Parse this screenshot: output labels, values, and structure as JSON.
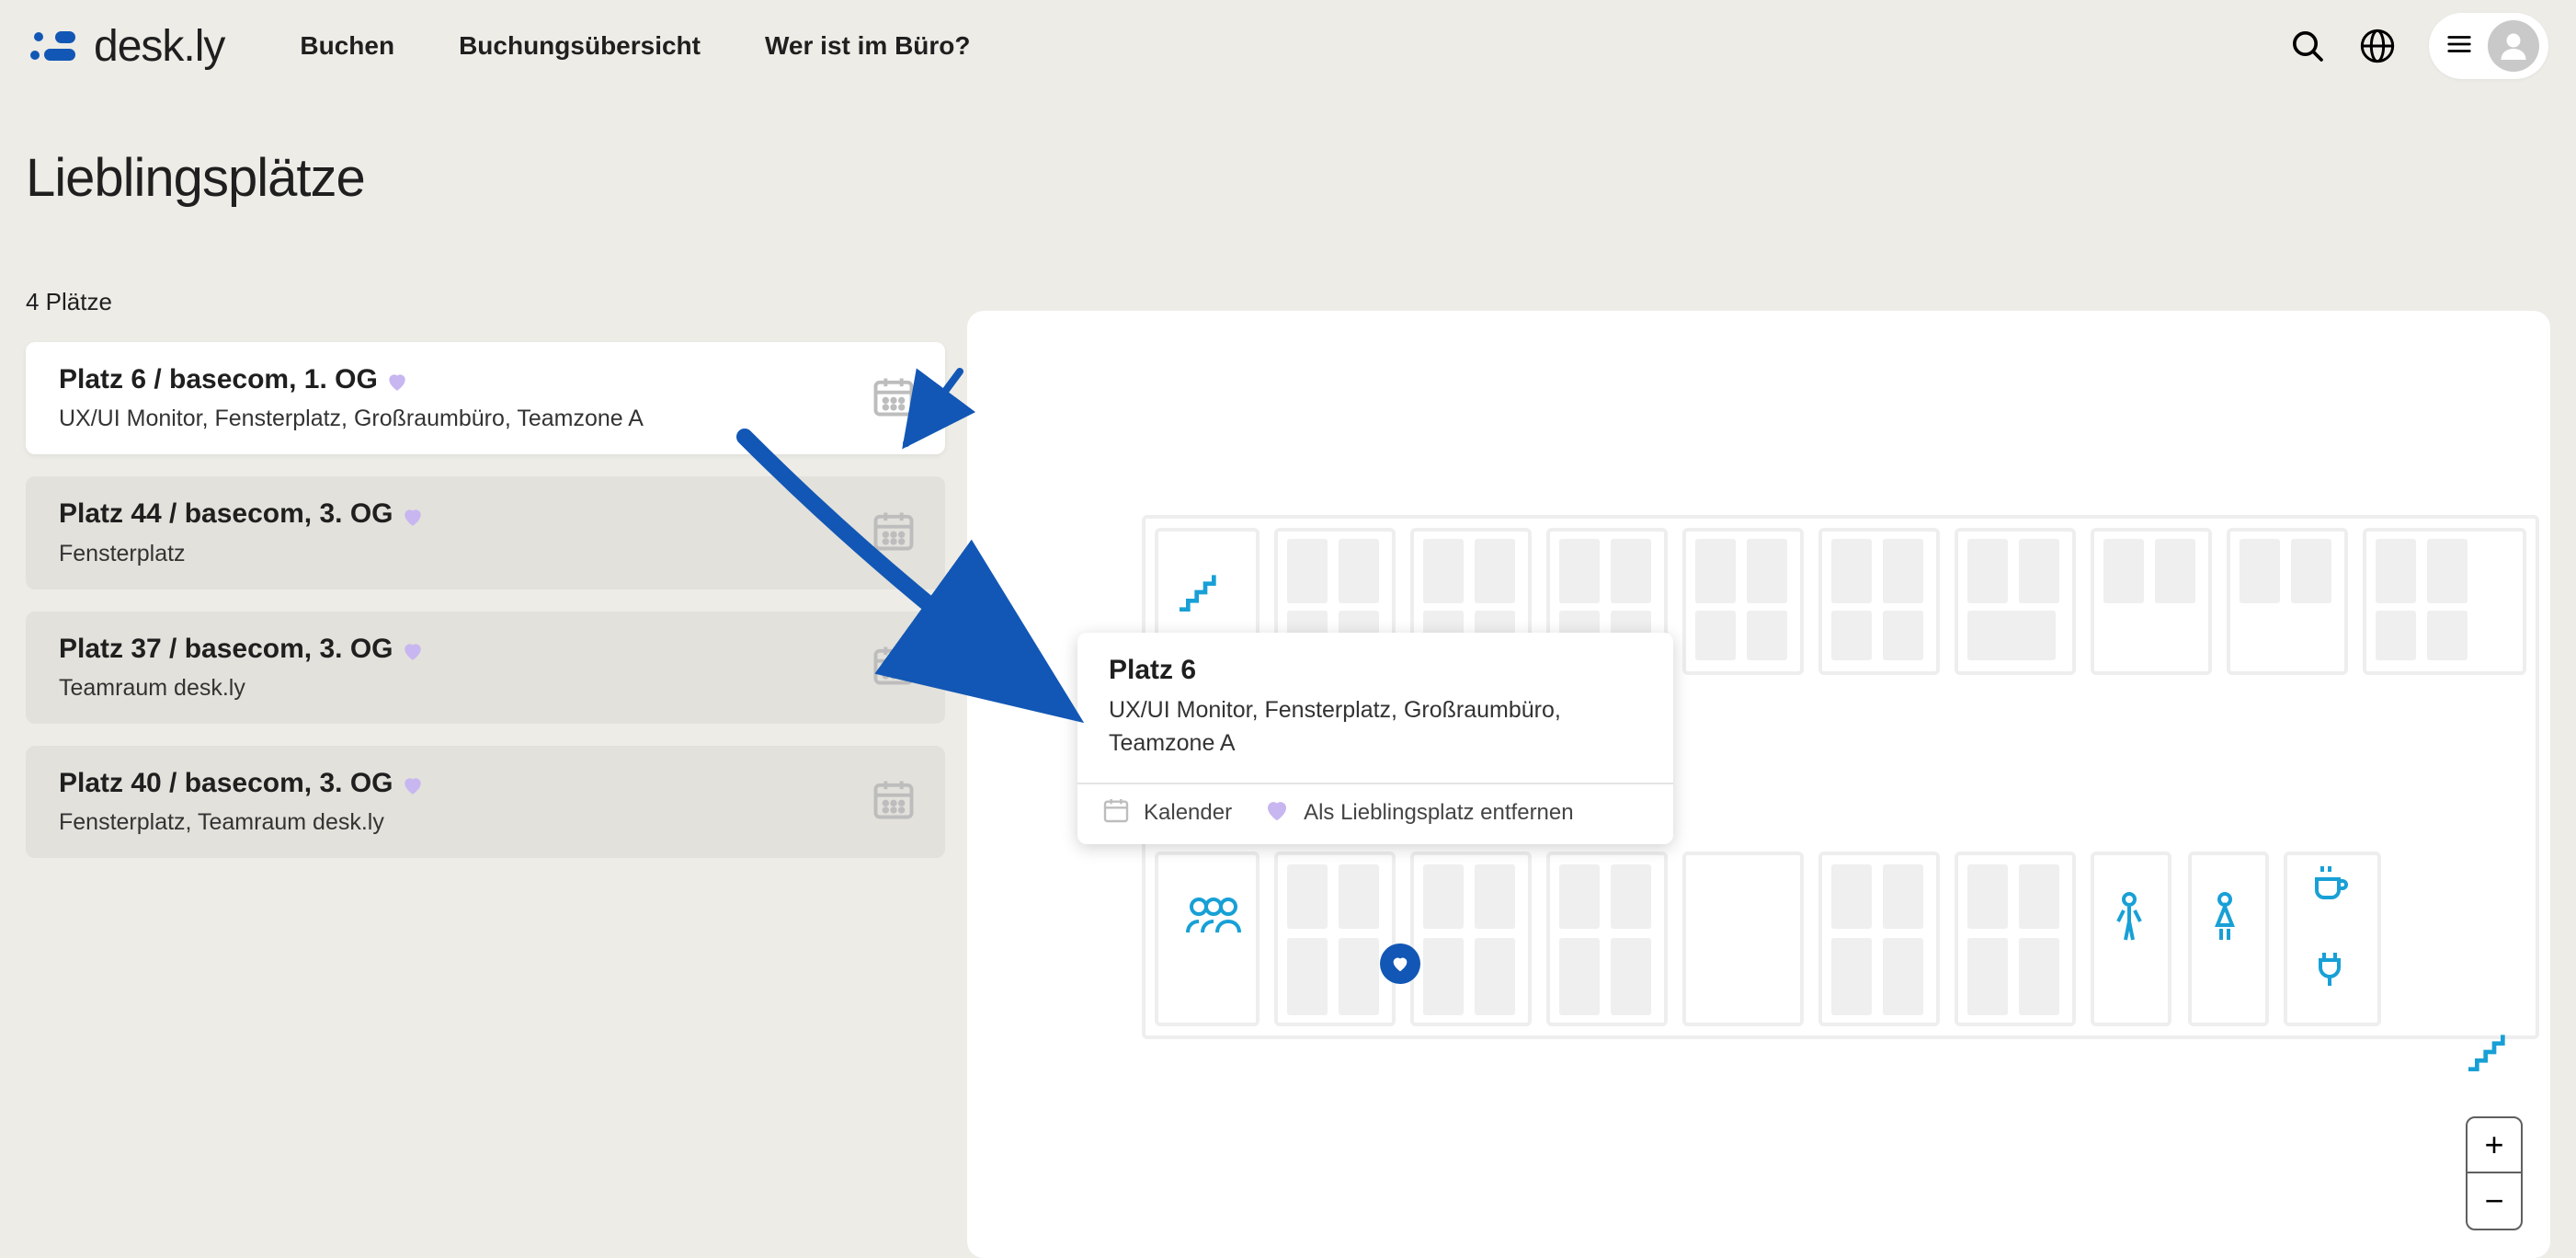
{
  "nav": {
    "brand": "desk.ly",
    "links": [
      "Buchen",
      "Buchungsübersicht",
      "Wer ist im Büro?"
    ]
  },
  "page": {
    "title": "Lieblingsplätze",
    "places_count": "4 Plätze"
  },
  "places": [
    {
      "title": "Platz 6 / basecom, 1. OG",
      "sub": "UX/UI Monitor, Fensterplatz, Großraumbüro, Teamzone A"
    },
    {
      "title": "Platz 44 / basecom, 3. OG",
      "sub": "Fensterplatz"
    },
    {
      "title": "Platz 37 / basecom, 3. OG",
      "sub": "Teamraum desk.ly"
    },
    {
      "title": "Platz 40 / basecom, 3. OG",
      "sub": "Fensterplatz, Teamraum desk.ly"
    }
  ],
  "popover": {
    "title": "Platz 6",
    "sub": "UX/UI Monitor, Fensterplatz, Großraumbüro, Teamzone A",
    "calendar": "Kalender",
    "unfav": "Als Lieblingsplatz entfernen"
  },
  "zoom": {
    "in": "+",
    "out": "−"
  }
}
